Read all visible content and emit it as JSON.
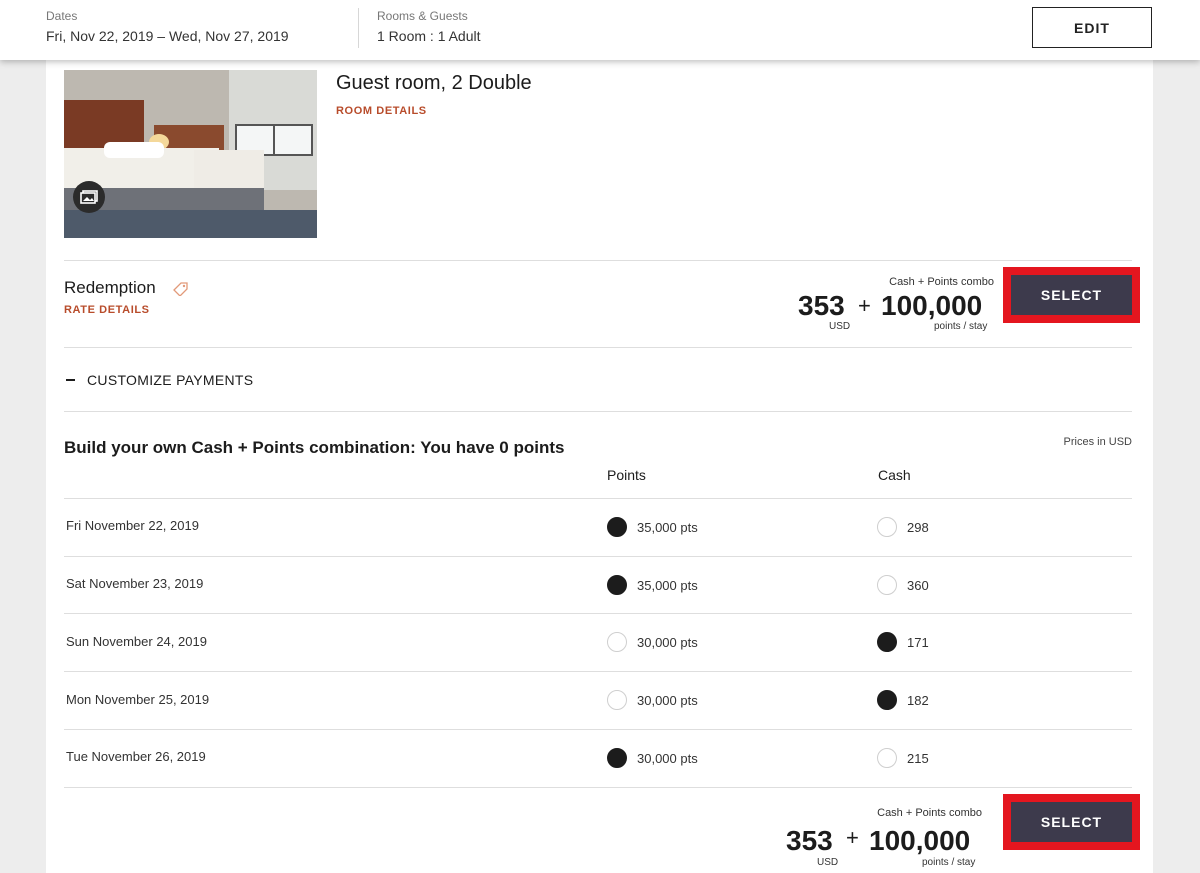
{
  "header": {
    "dates_label": "Dates",
    "dates_value": "Fri, Nov 22, 2019 – Wed, Nov 27, 2019",
    "rooms_label": "Rooms & Guests",
    "rooms_value": "1 Room : 1 Adult",
    "edit_label": "EDIT"
  },
  "room": {
    "title": "Guest room, 2 Double",
    "details_link": "ROOM DETAILS",
    "image_icon": "gallery-icon"
  },
  "rate": {
    "title": "Redemption",
    "details_link": "RATE DETAILS",
    "tag_icon": "tag-icon",
    "combo_label": "Cash + Points combo",
    "cash": "353",
    "plus": "+",
    "points": "100,000",
    "cash_unit": "USD",
    "points_unit": "points / stay",
    "select_label": "SELECT"
  },
  "customize": {
    "label": "CUSTOMIZE PAYMENTS"
  },
  "builder": {
    "title": "Build your own Cash + Points combination: You have 0 points",
    "prices_in": "Prices in USD",
    "col_points": "Points",
    "col_cash": "Cash",
    "rows": [
      {
        "date": "Fri November 22, 2019",
        "points": "35,000 pts",
        "cash": "298",
        "selected": "points"
      },
      {
        "date": "Sat November 23, 2019",
        "points": "35,000 pts",
        "cash": "360",
        "selected": "points"
      },
      {
        "date": "Sun November 24, 2019",
        "points": "30,000 pts",
        "cash": "171",
        "selected": "cash"
      },
      {
        "date": "Mon November 25, 2019",
        "points": "30,000 pts",
        "cash": "182",
        "selected": "cash"
      },
      {
        "date": "Tue November 26, 2019",
        "points": "30,000 pts",
        "cash": "215",
        "selected": "points"
      }
    ]
  },
  "total": {
    "combo_label": "Cash + Points combo",
    "cash": "353",
    "plus": "+",
    "points": "100,000",
    "cash_unit": "USD",
    "points_unit": "points / stay",
    "select_label": "SELECT"
  },
  "colors": {
    "accent_red": "#b84c2b",
    "highlight_red": "#e4161f",
    "button_dark": "#3d3a4c"
  }
}
